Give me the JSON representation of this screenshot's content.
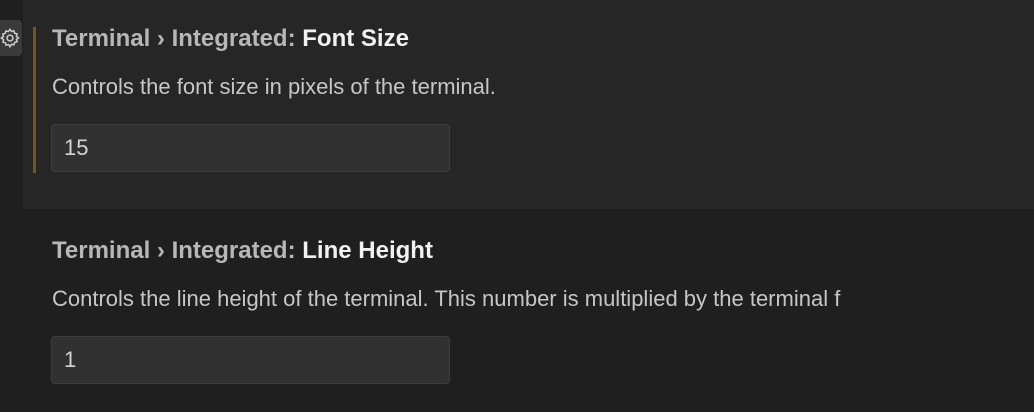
{
  "settings": [
    {
      "category": "Terminal › Integrated: ",
      "name": "Font Size",
      "description": "Controls the font size in pixels of the terminal.",
      "value": "15",
      "modified": true,
      "focused": true
    },
    {
      "category": "Terminal › Integrated: ",
      "name": "Line Height",
      "description": "Controls the line height of the terminal. This number is multiplied by the terminal f",
      "value": "1",
      "modified": false,
      "focused": false
    }
  ],
  "colors": {
    "modified_indicator": "#74561b",
    "focused_row_bg": "#262626",
    "page_bg": "#1f1f1f"
  },
  "icons": {
    "settings_gear": "gear-icon"
  }
}
